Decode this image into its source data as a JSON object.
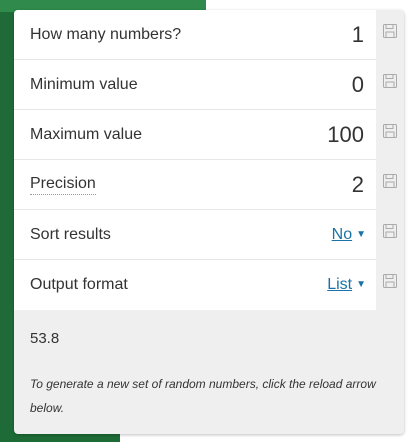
{
  "form": {
    "rows": [
      {
        "label": "How many numbers?",
        "value": "1"
      },
      {
        "label": "Minimum value",
        "value": "0"
      },
      {
        "label": "Maximum value",
        "value": "100"
      },
      {
        "label": "Precision",
        "value": "2"
      },
      {
        "label": "Sort results",
        "select": "No"
      },
      {
        "label": "Output format",
        "select": "List"
      }
    ]
  },
  "icons": {
    "save": "floppy-disk-icon",
    "dropdown": "caret-down-icon"
  },
  "result": {
    "text": "53.8"
  },
  "note": {
    "text": "To generate a new set of random numbers, click the reload arrow below."
  },
  "colors": {
    "link": "#1a73a8",
    "background_green": "#1f6b38",
    "panel_bg": "#efefef"
  }
}
